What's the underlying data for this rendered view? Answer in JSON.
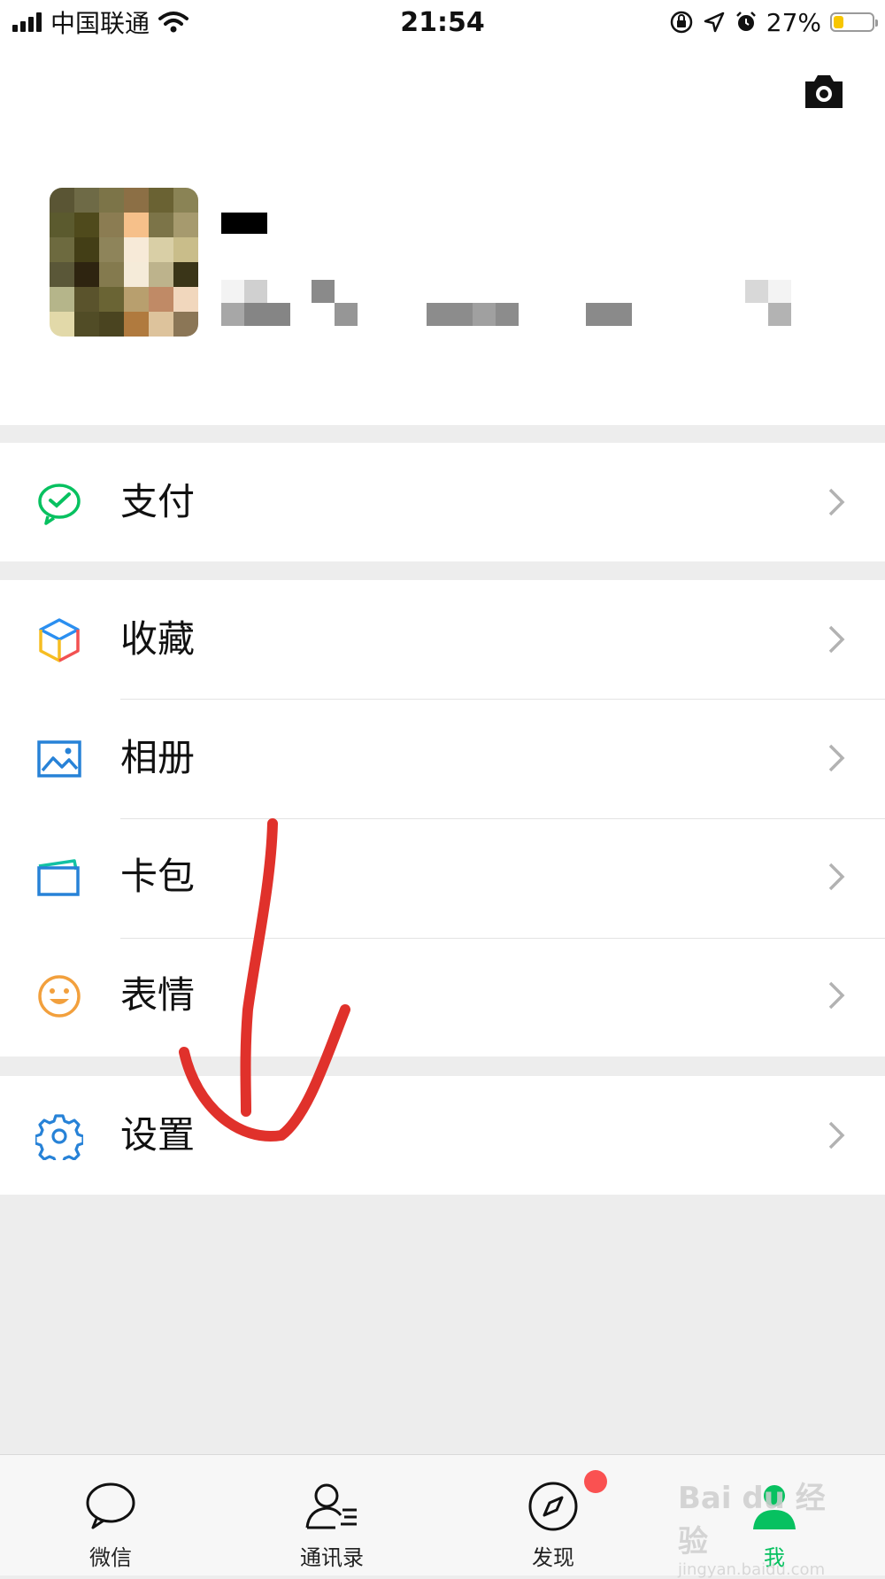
{
  "status_bar": {
    "carrier": "中国联通",
    "time": "21:54",
    "battery": "27%",
    "battery_level": 0.27,
    "battery_color": "#f7c600"
  },
  "header": {
    "camera_icon": "camera-icon"
  },
  "profile": {
    "nickname": "(redacted)",
    "wechat_id": "(redacted)"
  },
  "menu": {
    "pay": {
      "label": "支付",
      "icon": "wechat-pay-icon",
      "color": "#07c160"
    },
    "favorites": {
      "label": "收藏",
      "icon": "favorites-cube-icon"
    },
    "album": {
      "label": "相册",
      "icon": "album-icon",
      "color": "#2782d7"
    },
    "cards": {
      "label": "卡包",
      "icon": "card-wallet-icon",
      "color": "#2782d7"
    },
    "stickers": {
      "label": "表情",
      "icon": "sticker-smiley-icon",
      "color": "#f2a03d"
    },
    "settings": {
      "label": "设置",
      "icon": "settings-gear-icon",
      "color": "#2782d7"
    }
  },
  "tabbar": {
    "chats": {
      "label": "微信",
      "icon": "chat-bubble-icon"
    },
    "contacts": {
      "label": "通讯录",
      "icon": "contacts-icon"
    },
    "discover": {
      "label": "发现",
      "icon": "compass-icon",
      "badge": true
    },
    "me": {
      "label": "我",
      "icon": "me-icon",
      "active": true,
      "color": "#07c160"
    }
  },
  "watermark": {
    "brand": "Bai du 经验",
    "url": "jingyan.baidu.com"
  },
  "annotation": {
    "type": "red hand-drawn arrow pointing to settings",
    "color": "#e0312b"
  }
}
